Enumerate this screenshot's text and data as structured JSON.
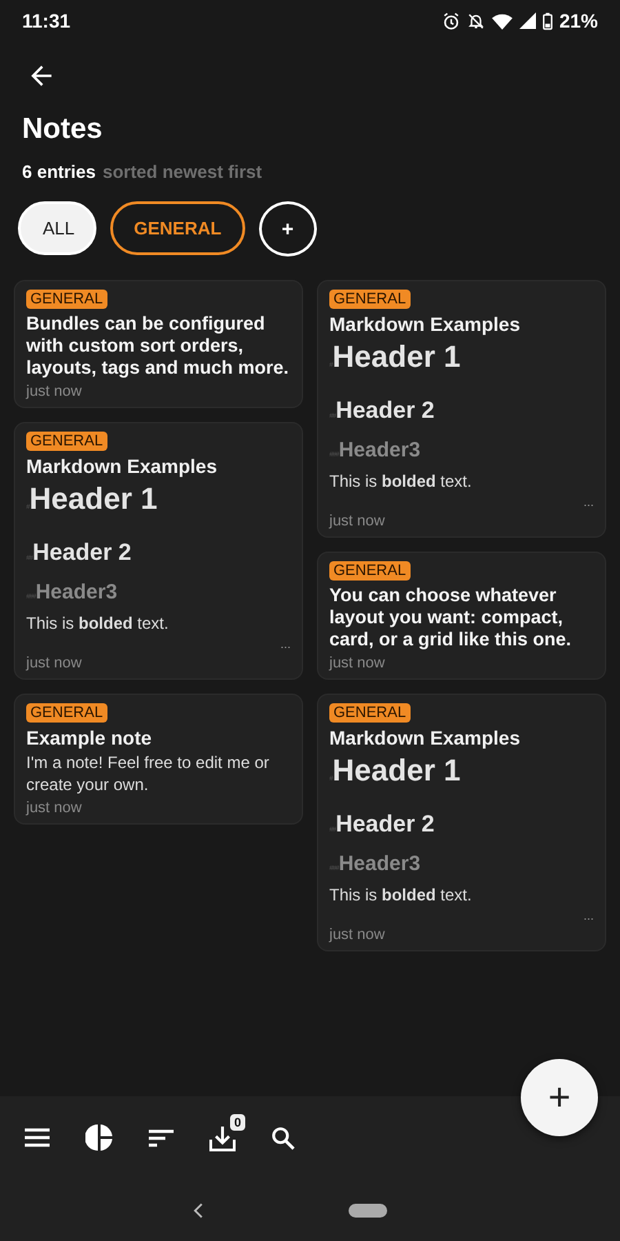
{
  "status_bar": {
    "time": "11:31",
    "battery": "21%"
  },
  "header": {
    "title": "Notes",
    "count": "6 entries",
    "sort": "sorted newest first"
  },
  "filters": [
    {
      "kind": "chip",
      "label": "ALL",
      "selected": true
    },
    {
      "kind": "chip",
      "label": "GENERAL",
      "selected": false,
      "color": "#f08a24"
    },
    {
      "kind": "add",
      "label": "+",
      "selected": false
    }
  ],
  "columns": [
    [
      {
        "kind": "text",
        "tag": "GENERAL",
        "body": "Bundles can be configured with custom sort orders, layouts, tags and much more.",
        "time": "just now"
      },
      {
        "kind": "markdown",
        "tag": "GENERAL",
        "title": "Markdown Examples",
        "headers": [
          {
            "mark": "#",
            "text": "Header 1"
          },
          {
            "mark": "##",
            "text": "Header 2"
          },
          {
            "mark": "###",
            "text": "Header3"
          }
        ],
        "body": "This is **bolded** text.",
        "more": "...",
        "time": "just now"
      },
      {
        "kind": "titled",
        "tag": "GENERAL",
        "title": "Example note",
        "body": "I'm a note! Feel free to edit me or create your own.",
        "time": "just now"
      }
    ],
    [
      {
        "kind": "markdown",
        "tag": "GENERAL",
        "title": "Markdown Examples",
        "headers": [
          {
            "mark": "#",
            "text": "Header 1"
          },
          {
            "mark": "##",
            "text": "Header 2"
          },
          {
            "mark": "###",
            "text": "Header3"
          }
        ],
        "body": "This is **bolded** text.",
        "more": "...",
        "time": "just now"
      },
      {
        "kind": "text",
        "tag": "GENERAL",
        "body": "You can choose whatever layout you want: compact, card, or a grid like this one.",
        "time": "just now"
      },
      {
        "kind": "markdown",
        "tag": "GENERAL",
        "title": "Markdown Examples",
        "headers": [
          {
            "mark": "#",
            "text": "Header 1"
          },
          {
            "mark": "##",
            "text": "Header 2"
          },
          {
            "mark": "###",
            "text": "Header3"
          }
        ],
        "body": "This is **bolded** text.",
        "more": "...",
        "time": "just now"
      }
    ]
  ],
  "fab": {
    "label": "+"
  },
  "toolbar": {
    "inbox_badge": "0"
  }
}
